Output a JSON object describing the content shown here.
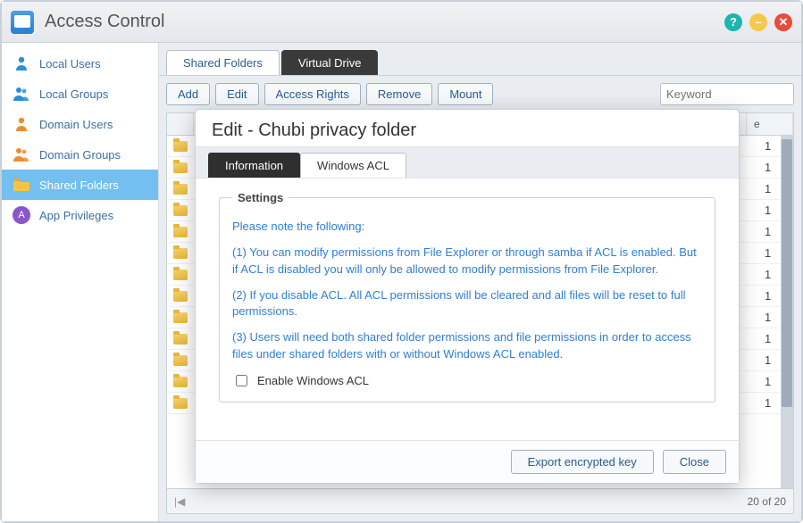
{
  "titlebar": {
    "title": "Access Control"
  },
  "sidebar": {
    "items": [
      {
        "label": "Local Users"
      },
      {
        "label": "Local Groups"
      },
      {
        "label": "Domain Users"
      },
      {
        "label": "Domain Groups"
      },
      {
        "label": "Shared Folders"
      },
      {
        "label": "App Privileges"
      }
    ]
  },
  "main": {
    "tabs": {
      "shared": "Shared Folders",
      "virtual": "Virtual Drive"
    },
    "toolbar": {
      "add": "Add",
      "edit": "Edit",
      "rights": "Access Rights",
      "remove": "Remove",
      "mount": "Mount",
      "search_placeholder": "Keyword"
    },
    "grid": {
      "header_right": "e",
      "value_right": "1",
      "pager_text": "20 of 20",
      "pager_first": "|◀"
    }
  },
  "modal": {
    "title": "Edit - Chubi privacy folder",
    "tabs": {
      "info": "Information",
      "acl": "Windows ACL"
    },
    "legend": "Settings",
    "note_intro": "Please note the following:",
    "note1": "(1) You can modify permissions from File Explorer or through samba if ACL is enabled. But if ACL is disabled you will only be allowed to modify permissions from File Explorer.",
    "note2": "(2) If you disable ACL. All ACL permissions will be cleared and all files will be reset to full permissions.",
    "note3": "(3) Users will need both shared folder permissions and file permissions in order to access files under shared folders with or without Windows ACL enabled.",
    "checkbox_label": "Enable Windows ACL",
    "footer": {
      "export": "Export encrypted key",
      "close": "Close"
    }
  }
}
